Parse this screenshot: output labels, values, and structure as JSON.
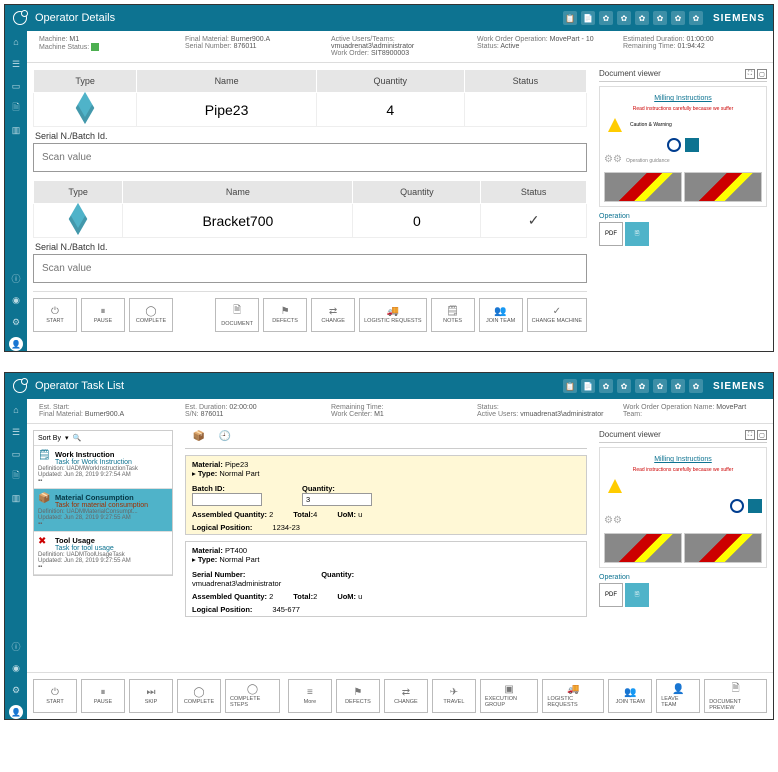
{
  "brand": "SIEMENS",
  "screen1": {
    "title": "Operator Details",
    "info": {
      "machine_lbl": "Machine:",
      "machine": "M1",
      "status_lbl": "Machine Status:",
      "final_lbl": "Final Material:",
      "final": "Burner900.A",
      "sn_lbl": "Serial Number:",
      "sn": "876011",
      "users_lbl": "Active Users/Teams:",
      "users": "vmuadrenat3\\administrator",
      "wo_lbl": "Work Order:",
      "wo": "SIT8900003",
      "op_lbl": "Work Order Operation:",
      "op": "MovePart - 10",
      "st_lbl": "Status:",
      "st": "Active",
      "dur_lbl": "Estimated Duration:",
      "dur": "01:00:00",
      "rem_lbl": "Remaining Time:",
      "rem": "01:94:42"
    },
    "cols": {
      "type": "Type",
      "name": "Name",
      "qty": "Quantity",
      "status": "Status"
    },
    "parts": [
      {
        "name": "Pipe23",
        "qty": "4",
        "status": ""
      },
      {
        "name": "Bracket700",
        "qty": "0",
        "status": "✓"
      }
    ],
    "serial_label": "Serial N./Batch Id.",
    "scan_placeholder": "Scan value",
    "buttons": {
      "start": "START",
      "pause": "PAUSE",
      "complete": "COMPLETE",
      "document": "DOCUMENT",
      "defects": "DEFECTS",
      "change": "CHANGE",
      "logistic": "LOGISTIC REQUESTS",
      "notes": "NOTES",
      "join": "JOIN TEAM",
      "chmachine": "CHANGE MACHINE"
    }
  },
  "screen2": {
    "title": "Operator Task List",
    "info": {
      "start_lbl": "Est. Start:",
      "final_lbl": "Final Material:",
      "final": "Burner900.A",
      "dur_lbl": "Est. Duration:",
      "dur": "02:00:00",
      "sn_lbl": "S/N:",
      "sn": "876011",
      "rem_lbl": "Remaining Time:",
      "wc_lbl": "Work Center:",
      "wc": "M1",
      "st_lbl": "Status:",
      "users_lbl": "Active Users:",
      "users": "vmuadrenat3\\administrator",
      "op_lbl": "Work Order Operation Name:",
      "op": "MovePart",
      "team_lbl": "Team:"
    },
    "sort": "Sort By",
    "tasks": [
      {
        "title": "Work Instruction",
        "link": "Task for Work Instruction",
        "def": "Definition: UADMWorkInstructionTask",
        "upd": "Updated: Jun 28, 2019 9:27:54 AM"
      },
      {
        "title": "Material Consumption",
        "link": "Task for material consumption",
        "def": "Definition: UADMMaterialConsumpt...",
        "upd": "Updated: Jun 28, 2019 9:27:55 AM"
      },
      {
        "title": "Tool Usage",
        "link": "Task for tool usage",
        "def": "Definition: UADMToolUsageTask",
        "upd": "Updated: Jun 28, 2019 9:27:55 AM"
      }
    ],
    "mat1": {
      "mat_l": "Material:",
      "mat": "Pipe23",
      "type_l": "Type:",
      "type": "Normal Part",
      "batch_l": "Batch ID:",
      "batch": "",
      "qty_l": "Quantity:",
      "qty": "3",
      "asm_l": "Assembled Quantity:",
      "asm": "2",
      "tot_l": "Total:",
      "tot": "4",
      "uom_l": "UoM:",
      "uom": "u",
      "pos_l": "Logical Position:",
      "pos": "1234-23"
    },
    "mat2": {
      "mat_l": "Material:",
      "mat": "PT400",
      "type_l": "Type:",
      "type": "Normal Part",
      "sn_l": "Serial Number:",
      "sn": "vmuadrenat3\\administrator",
      "qty_l": "Quantity:",
      "asm_l": "Assembled Quantity:",
      "asm": "2",
      "tot_l": "Total:",
      "tot": "2",
      "uom_l": "UoM:",
      "uom": "u",
      "pos_l": "Logical Position:",
      "pos": "345-677"
    },
    "buttons": {
      "start": "START",
      "pause": "PAUSE",
      "skip": "SKIP",
      "complete": "COMPLETE",
      "csteps": "COMPLETE STEPS",
      "more": "More",
      "defects": "DEFECTS",
      "change": "CHANGE",
      "travel": "TRAVEL",
      "execgrp": "EXECUTION GROUP",
      "logistic": "LOGISTIC REQUESTS",
      "join": "JOIN TEAM",
      "leave": "LEAVE TEAM",
      "preview": "DOCUMENT PREVIEW"
    }
  },
  "dv": {
    "title": "Document viewer",
    "doctitle": "Milling Instructions",
    "red": "Read instructions carefully because we suffer",
    "op": "Operation"
  }
}
